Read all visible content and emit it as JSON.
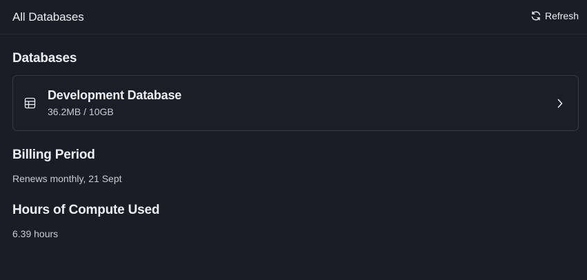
{
  "header": {
    "title": "All Databases",
    "refresh_label": "Refresh"
  },
  "databases": {
    "title": "Databases",
    "items": [
      {
        "name": "Development Database",
        "usage": "36.2MB / 10GB"
      }
    ]
  },
  "billing": {
    "title": "Billing Period",
    "value": "Renews monthly, 21 Sept"
  },
  "compute": {
    "title": "Hours of Compute Used",
    "value": "6.39 hours"
  },
  "icons": {
    "refresh": "refresh-icon",
    "database": "table-icon",
    "chevron": "chevron-right-icon"
  }
}
